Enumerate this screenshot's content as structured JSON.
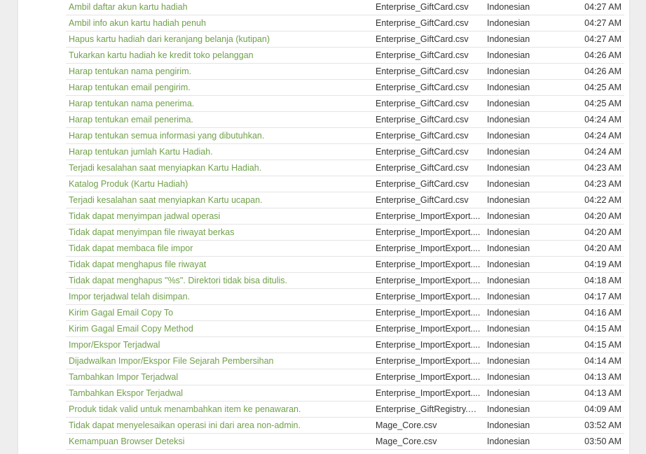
{
  "colors": {
    "link": "#6fa04a",
    "text": "#333333",
    "row_border": "#e4e4e4",
    "page_bg": "#eeeeee"
  },
  "rows": [
    {
      "label": "Ambil daftar akun kartu hadiah",
      "file": "Enterprise_GiftCard.csv",
      "language": "Indonesian",
      "time": "04:27 AM"
    },
    {
      "label": "Ambil info akun kartu hadiah penuh",
      "file": "Enterprise_GiftCard.csv",
      "language": "Indonesian",
      "time": "04:27 AM"
    },
    {
      "label": "Hapus kartu hadiah dari keranjang belanja (kutipan)",
      "file": "Enterprise_GiftCard.csv",
      "language": "Indonesian",
      "time": "04:27 AM"
    },
    {
      "label": "Tukarkan kartu hadiah ke kredit toko pelanggan",
      "file": "Enterprise_GiftCard.csv",
      "language": "Indonesian",
      "time": "04:26 AM"
    },
    {
      "label": "Harap tentukan nama pengirim.",
      "file": "Enterprise_GiftCard.csv",
      "language": "Indonesian",
      "time": "04:26 AM"
    },
    {
      "label": "Harap tentukan email pengirim.",
      "file": "Enterprise_GiftCard.csv",
      "language": "Indonesian",
      "time": "04:25 AM"
    },
    {
      "label": "Harap tentukan nama penerima.",
      "file": "Enterprise_GiftCard.csv",
      "language": "Indonesian",
      "time": "04:25 AM"
    },
    {
      "label": "Harap tentukan email penerima.",
      "file": "Enterprise_GiftCard.csv",
      "language": "Indonesian",
      "time": "04:24 AM"
    },
    {
      "label": "Harap tentukan semua informasi yang dibutuhkan.",
      "file": "Enterprise_GiftCard.csv",
      "language": "Indonesian",
      "time": "04:24 AM"
    },
    {
      "label": "Harap tentukan jumlah Kartu Hadiah.",
      "file": "Enterprise_GiftCard.csv",
      "language": "Indonesian",
      "time": "04:24 AM"
    },
    {
      "label": "Terjadi kesalahan saat menyiapkan Kartu Hadiah.",
      "file": "Enterprise_GiftCard.csv",
      "language": "Indonesian",
      "time": "04:23 AM"
    },
    {
      "label": "Katalog Produk (Kartu Hadiah)",
      "file": "Enterprise_GiftCard.csv",
      "language": "Indonesian",
      "time": "04:23 AM"
    },
    {
      "label": "Terjadi kesalahan saat menyiapkan Kartu ucapan.",
      "file": "Enterprise_GiftCard.csv",
      "language": "Indonesian",
      "time": "04:22 AM"
    },
    {
      "label": "Tidak dapat menyimpan jadwal operasi",
      "file": "Enterprise_ImportExport....",
      "language": "Indonesian",
      "time": "04:20 AM"
    },
    {
      "label": "Tidak dapat menyimpan file riwayat berkas",
      "file": "Enterprise_ImportExport....",
      "language": "Indonesian",
      "time": "04:20 AM"
    },
    {
      "label": "Tidak dapat membaca file impor",
      "file": "Enterprise_ImportExport....",
      "language": "Indonesian",
      "time": "04:20 AM"
    },
    {
      "label": "Tidak dapat menghapus file riwayat",
      "file": "Enterprise_ImportExport....",
      "language": "Indonesian",
      "time": "04:19 AM"
    },
    {
      "label": "Tidak dapat menghapus \"%s\". Direktori tidak bisa ditulis.",
      "file": "Enterprise_ImportExport....",
      "language": "Indonesian",
      "time": "04:18 AM"
    },
    {
      "label": "Impor terjadwal telah disimpan.",
      "file": "Enterprise_ImportExport....",
      "language": "Indonesian",
      "time": "04:17 AM"
    },
    {
      "label": "Kirim Gagal Email Copy To",
      "file": "Enterprise_ImportExport....",
      "language": "Indonesian",
      "time": "04:16 AM"
    },
    {
      "label": "Kirim Gagal Email Copy Method",
      "file": "Enterprise_ImportExport....",
      "language": "Indonesian",
      "time": "04:15 AM"
    },
    {
      "label": "Impor/Ekspor Terjadwal",
      "file": "Enterprise_ImportExport....",
      "language": "Indonesian",
      "time": "04:15 AM"
    },
    {
      "label": "Dijadwalkan Impor/Ekspor File Sejarah Pembersihan",
      "file": "Enterprise_ImportExport....",
      "language": "Indonesian",
      "time": "04:14 AM"
    },
    {
      "label": "Tambahkan Impor Terjadwal",
      "file": "Enterprise_ImportExport....",
      "language": "Indonesian",
      "time": "04:13 AM"
    },
    {
      "label": "Tambahkan Ekspor Terjadwal",
      "file": "Enterprise_ImportExport....",
      "language": "Indonesian",
      "time": "04:13 AM"
    },
    {
      "label": "Produk tidak valid untuk menambahkan item ke penawaran.",
      "file": "Enterprise_GiftRegistry.csv",
      "language": "Indonesian",
      "time": "04:09 AM"
    },
    {
      "label": "Tidak dapat menyelesaikan operasi ini dari area non-admin.",
      "file": "Mage_Core.csv",
      "language": "Indonesian",
      "time": "03:52 AM"
    },
    {
      "label": "Kemampuan Browser Deteksi",
      "file": "Mage_Core.csv",
      "language": "Indonesian",
      "time": "03:50 AM"
    }
  ]
}
